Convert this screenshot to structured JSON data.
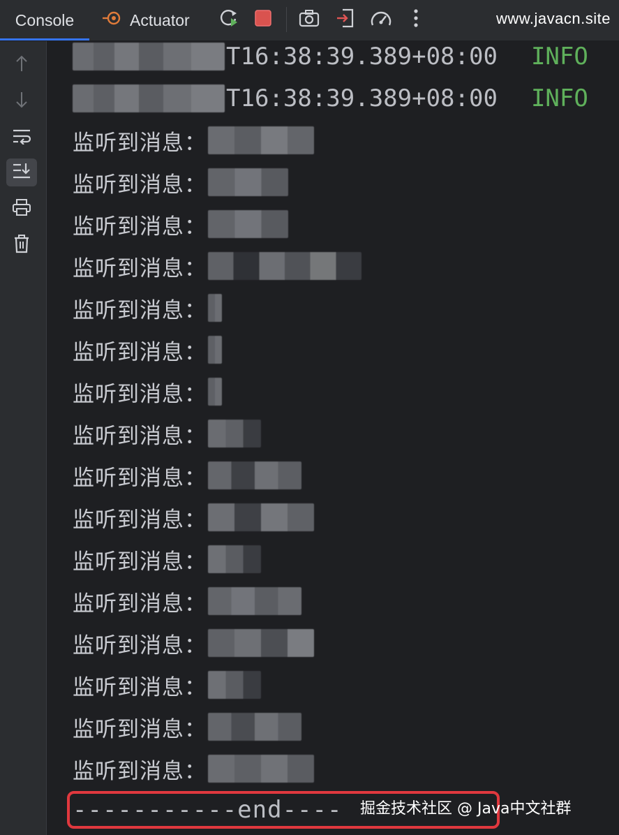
{
  "toolbar": {
    "tabs": [
      {
        "label": "Console",
        "active": true
      },
      {
        "label": "Actuator",
        "active": false
      }
    ],
    "icons": [
      "rerun-icon",
      "stop-icon",
      "screenshot-icon",
      "export-icon",
      "dashboard-icon",
      "more-icon"
    ],
    "site": "www.javacn.site"
  },
  "gutter": {
    "icons": [
      "up-arrow-icon",
      "down-arrow-icon",
      "soft-wrap-icon",
      "scroll-to-end-icon",
      "print-icon",
      "trash-icon"
    ],
    "active": "scroll-to-end-icon"
  },
  "log": {
    "header_lines": [
      {
        "timestamp": "T16:38:39.389+08:00",
        "level": "INFO"
      },
      {
        "timestamp": "T16:38:39.389+08:00",
        "level": "INFO"
      }
    ],
    "message_label": "监听到消息：",
    "message_count": 16,
    "end_line": "-----------end----",
    "colors": {
      "info": "#5fb05b",
      "highlight": "#e0383e",
      "accent": "#3574f0"
    }
  },
  "watermark": "掘金技术社区 @ Java中文社群"
}
